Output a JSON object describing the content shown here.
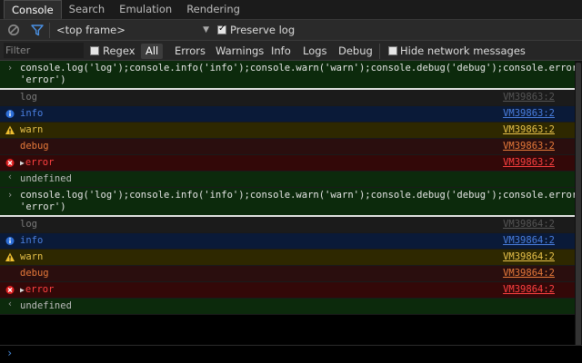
{
  "tabs": [
    {
      "label": "Console",
      "active": true
    },
    {
      "label": "Search",
      "active": false
    },
    {
      "label": "Emulation",
      "active": false
    },
    {
      "label": "Rendering",
      "active": false
    }
  ],
  "toolbar": {
    "frame_select": "<top frame>",
    "preserve_log_label": "Preserve log",
    "preserve_log_checked": true,
    "icons": [
      "clear-console-icon",
      "filter-icon"
    ]
  },
  "filter": {
    "placeholder": "Filter",
    "regex_label": "Regex",
    "levels": [
      "All",
      "Errors",
      "Warnings",
      "Info",
      "Logs",
      "Debug"
    ],
    "active_level": "All",
    "hide_network_label": "Hide network messages"
  },
  "entries": [
    {
      "command": "console.log('log');console.info('info');console.warn('warn');console.debug('debug');console.error(\n'error')",
      "messages": [
        {
          "type": "log",
          "text": "log",
          "source": "VM39863:2"
        },
        {
          "type": "info",
          "text": "info",
          "source": "VM39863:2"
        },
        {
          "type": "warn",
          "text": "warn",
          "source": "VM39863:2"
        },
        {
          "type": "debug",
          "text": "debug",
          "source": "VM39863:2"
        },
        {
          "type": "error",
          "text": "error",
          "source": "VM39863:2"
        }
      ],
      "result": "undefined"
    },
    {
      "command": "console.log('log');console.info('info');console.warn('warn');console.debug('debug');console.error(\n'error')",
      "messages": [
        {
          "type": "log",
          "text": "log",
          "source": "VM39864:2"
        },
        {
          "type": "info",
          "text": "info",
          "source": "VM39864:2"
        },
        {
          "type": "warn",
          "text": "warn",
          "source": "VM39864:2"
        },
        {
          "type": "debug",
          "text": "debug",
          "source": "VM39864:2"
        },
        {
          "type": "error",
          "text": "error",
          "source": "VM39864:2"
        }
      ],
      "result": "undefined"
    }
  ],
  "colors": {
    "log": "#7a7a7a",
    "info": "#4a7fe0",
    "warn": "#e8c24a",
    "debug": "#e87a3a",
    "error": "#ff4040",
    "command_bg": "#0c2a0c"
  }
}
